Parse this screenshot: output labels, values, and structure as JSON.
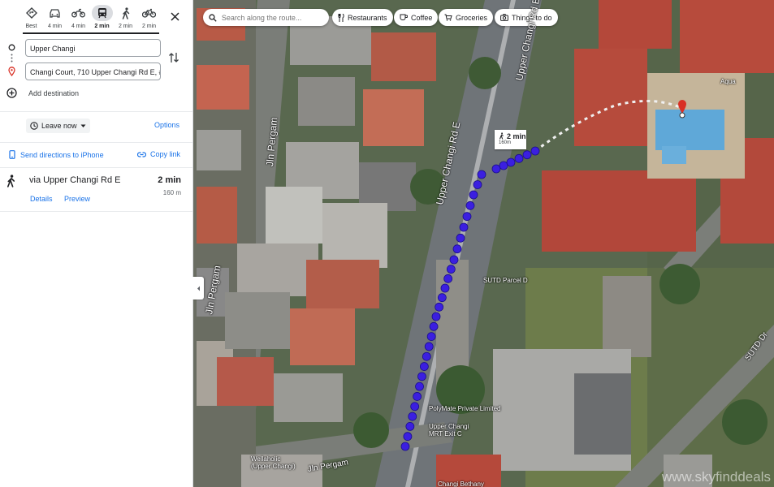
{
  "travel_modes": [
    {
      "name": "best",
      "label": "Best"
    },
    {
      "name": "driving",
      "label": "4 min"
    },
    {
      "name": "motorcycle",
      "label": "4 min"
    },
    {
      "name": "transit",
      "label": "2 min"
    },
    {
      "name": "walking",
      "label": "2 min"
    },
    {
      "name": "cycling",
      "label": "2 min"
    }
  ],
  "directions": {
    "origin": "Upper Changi",
    "destination": "Changi Court, 710 Upper Changi Rd E, #",
    "add_destination": "Add destination"
  },
  "depart": {
    "leave_label": "Leave now",
    "options_label": "Options"
  },
  "share": {
    "send_label": "Send directions to iPhone",
    "copy_label": "Copy link"
  },
  "route": {
    "via": "via Upper Changi Rd E",
    "time": "2 min",
    "distance": "160 m",
    "details_label": "Details",
    "preview_label": "Preview"
  },
  "map": {
    "search_placeholder": "Search along the route...",
    "chips": [
      "Restaurants",
      "Coffee",
      "Groceries",
      "Things to do"
    ],
    "route_tip": {
      "time": "2 min",
      "distance": "160m"
    },
    "road_labels": [
      "Upper Changi Rd E",
      "Upper Changi Rd E",
      "Jln Pergam",
      "Jln Pergam",
      "Jln Pergam",
      "SUTD Dr"
    ],
    "poi_labels": [
      "SUTD Parcel D",
      "PolyMate Private Limited",
      "Upper Changi MRT Exit C",
      "Aqua",
      "Wellaholic (Upper Changi)",
      "Changi Bethany"
    ],
    "watermark": "www.skyfinddeals",
    "route_color": "#3b1fe0"
  }
}
